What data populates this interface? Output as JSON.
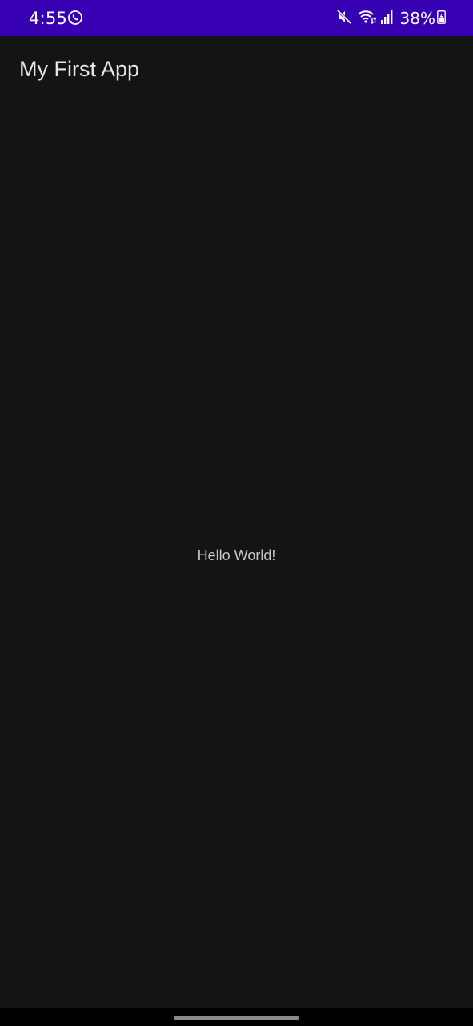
{
  "status_bar": {
    "time": "4:55",
    "battery_percent": "38%",
    "icons": [
      "whatsapp-icon",
      "mute-icon",
      "wifi-icon",
      "signal-icon",
      "battery-charging-icon"
    ],
    "background_color": "#3700b3"
  },
  "app_bar": {
    "title": "My First App"
  },
  "main": {
    "message": "Hello World!"
  },
  "colors": {
    "background": "#141414",
    "title_text": "#e8e8e8",
    "body_text": "#c8c8c8"
  }
}
